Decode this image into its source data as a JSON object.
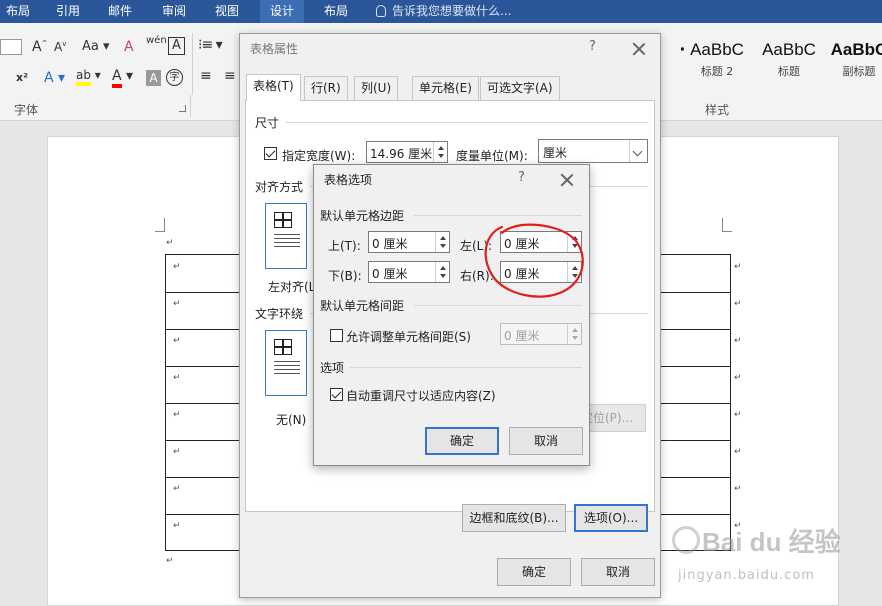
{
  "ribbon": {
    "tabs": [
      "布局",
      "引用",
      "邮件",
      "审阅",
      "视图",
      "设计",
      "布局"
    ],
    "active_tab_index": 5,
    "tell_me": "告诉我您想要做什么...",
    "font_group_label": "字体",
    "styles_group_label": "样式",
    "font_buttons": {
      "grow": "A",
      "shrink": "A",
      "case": "Aa",
      "clear": "A",
      "phonetic": "wén",
      "border": "A",
      "superscript": "x²",
      "text_effect": "A",
      "highlight": "ab",
      "font_color": "A",
      "shading": "A",
      "enclose": "字"
    },
    "styles": [
      {
        "preview": "AaBbC",
        "name": "标题 2"
      },
      {
        "preview": "AaBbC",
        "name": "标题"
      },
      {
        "preview": "AaBbC",
        "name": "副标题"
      }
    ],
    "colors": {
      "tab_bar": "#2b579a",
      "highlight": "#ffff00",
      "font_color": "#ff0000"
    }
  },
  "document": {
    "paragraph_mark": "↵",
    "table_rows": 8
  },
  "table_properties": {
    "title": "表格属性",
    "help": "?",
    "tabs": [
      "表格(T)",
      "行(R)",
      "列(U)",
      "单元格(E)",
      "可选文字(A)"
    ],
    "active_tab_index": 0,
    "size_section": "尺寸",
    "preferred_width_checked": true,
    "preferred_width_label": "指定宽度(W):",
    "preferred_width_value": "14.96 厘米",
    "measure_in_label": "度量单位(M):",
    "measure_in_value": "厘米",
    "alignment_section": "对齐方式",
    "alignment_option": "左对齐(L)",
    "wrapping_section": "文字环绕",
    "wrapping_option": "无(N)",
    "positioning_button": "定位(P)...",
    "borders_button": "边框和底纹(B)...",
    "options_button": "选项(O)...",
    "ok_button": "确定",
    "cancel_button": "取消"
  },
  "table_options": {
    "title": "表格选项",
    "help": "?",
    "margins_section": "默认单元格边距",
    "top_label": "上(T):",
    "top_value": "0 厘米",
    "left_label": "左(L):",
    "left_value": "0 厘米",
    "bottom_label": "下(B):",
    "bottom_value": "0 厘米",
    "right_label": "右(R):",
    "right_value": "0 厘米",
    "spacing_section": "默认单元格间距",
    "allow_spacing_checked": false,
    "allow_spacing_label": "允许调整单元格间距(S)",
    "spacing_value": "0 厘米",
    "options_section": "选项",
    "autoresize_checked": true,
    "autoresize_label": "自动重调尺寸以适应内容(Z)",
    "ok_button": "确定",
    "cancel_button": "取消"
  },
  "annotation": {
    "color": "#e0201a"
  },
  "watermark": {
    "text": "Bai du 经验",
    "url": "jingyan.baidu.com"
  }
}
